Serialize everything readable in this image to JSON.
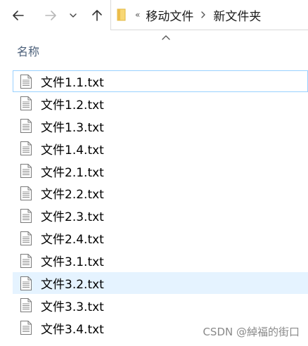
{
  "navigation": {
    "back_icon": "arrow-left-icon",
    "forward_icon": "arrow-right-icon",
    "recent_icon": "chevron-down-icon",
    "up_icon": "arrow-up-icon"
  },
  "address_bar": {
    "folder_icon": "folder-icon",
    "overflow": "«",
    "breadcrumbs": [
      {
        "label": "移动文件"
      },
      {
        "label": "新文件夹"
      }
    ]
  },
  "list_header": {
    "name_column": "名称",
    "sort_direction": "ascending"
  },
  "files": [
    {
      "name": "文件1.1.txt",
      "state": "focused"
    },
    {
      "name": "文件1.2.txt",
      "state": ""
    },
    {
      "name": "文件1.3.txt",
      "state": ""
    },
    {
      "name": "文件1.4.txt",
      "state": ""
    },
    {
      "name": "文件2.1.txt",
      "state": ""
    },
    {
      "name": "文件2.2.txt",
      "state": ""
    },
    {
      "name": "文件2.3.txt",
      "state": ""
    },
    {
      "name": "文件2.4.txt",
      "state": ""
    },
    {
      "name": "文件3.1.txt",
      "state": ""
    },
    {
      "name": "文件3.2.txt",
      "state": "hover"
    },
    {
      "name": "文件3.3.txt",
      "state": ""
    },
    {
      "name": "文件3.4.txt",
      "state": ""
    }
  ],
  "watermark": "CSDN @綽福的街口",
  "colors": {
    "hover_bg": "#e5f3ff",
    "focus_border": "#99d1ff",
    "header_text": "#4c607a",
    "folder_yellow": "#f8d775"
  }
}
